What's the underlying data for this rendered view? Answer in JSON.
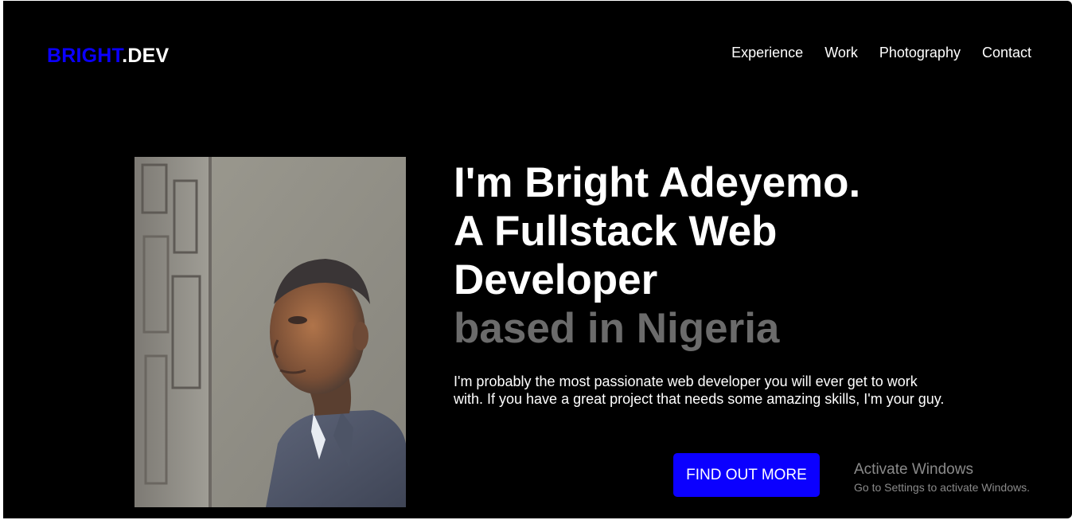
{
  "brand": {
    "accent_text": "BRIGHT",
    "rest_text": ".DEV",
    "accent_color": "#0b00ff"
  },
  "nav": {
    "items": [
      {
        "label": "Experience"
      },
      {
        "label": "Work"
      },
      {
        "label": "Photography"
      },
      {
        "label": "Contact"
      }
    ]
  },
  "hero": {
    "headline_line1": "I'm Bright Adeyemo.",
    "headline_line2": "A Fullstack Web",
    "headline_line3": "Developer",
    "headline_sub": "based in Nigeria",
    "description": "I'm probably the most passionate web developer you will ever get to work with. If you have a great project that needs some amazing skills, I'm your guy.",
    "cta_label": "FIND OUT MORE",
    "cta_color": "#0b00ff"
  },
  "watermark": {
    "title": "Activate Windows",
    "subtitle": "Go to Settings to activate Windows."
  },
  "colors": {
    "background": "#000000",
    "text": "#ffffff",
    "muted_text": "#6b6b6b"
  }
}
